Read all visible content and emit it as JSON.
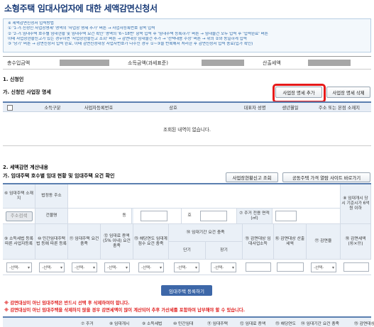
{
  "title": "소형주택 임대사업자에 대한 세액감면신청서",
  "guide": {
    "lines": [
      "※ 세액감면신청서 입력방법",
      "① '1-가.신청인 사업장명세' 영역의 '사업장 명세 추가' 버튼 → 사업자등록번호 항목 입력",
      "② '2-가.임대주택 호수별 임대현황 및 임대주택 요건 확인' 영역의 '6~18번' 항목 입력 후 '임대주택 등록하기' 버튼 → 임대물건 모두 입력 후 '입력완료' 버튼",
      "   이때 사업장현황신고가 있는 경우이면 '사업장현황신고 조회' 버튼 → 감면대상 임대물건 추가 → '선택내용 수정' 버튼 → 위의 ②와 동일하게 입력",
      "③ '당기' 버튼 → 감면신청서 입력 완료, 이때 감면신청대상 사업자번호가 다수인 경우 ①~③을 반복해서 처리한 후 감면신청서 입력 종료(입가 확인)"
    ]
  },
  "summary": {
    "total_income_label": "총수입금액",
    "income_amount_label": "소득금액(과세표준)",
    "tax_label": "산출세액"
  },
  "section1": {
    "heading": "1. 신청인",
    "subheading": "가. 신청인 사업장 명세",
    "add_button": "사업장 명세 추가",
    "delete_button": "사업장 명세 삭제",
    "columns": [
      "소득구분",
      "사업자등록번호",
      "상호",
      "대표자 성명",
      "생년월일",
      "주소 또는 본점 소재지"
    ],
    "empty_message": "조회된 내역이 없습니다."
  },
  "section2": {
    "heading": "2. 세액감면 계산내용",
    "subheading": "가. 임대주택 호수별 임대 현황 및 임대주택 요건 확인",
    "lookup_button": "사업장현황신고 조회",
    "price_button": "공동주택 가격 열람 사이트 바로가기",
    "row1": {
      "c1": "⑥ 임대주택 소재지",
      "c2": "법정동 주소",
      "c7": "⑧ 임대개시 당시 기준시가 6억원 이하"
    },
    "row2": {
      "address_search": "주소검색",
      "building_no": "건물명",
      "dong": "동",
      "ho": "호",
      "area": "⑦ 주거 전용 면적 (㎡)"
    },
    "row3": [
      "⑨ 소득세법 등록 따른 사업자등록",
      "⑩ 민간임대주택법 등에 따른 등록",
      "⑪ 임대주택 요건 충족",
      "⑫ 임대료 증액 (5% 이내) 요건 충족",
      "⑬ 해당연도 임대계점수 요건 충족",
      "⑭ 임대기간 요건 충족",
      "⑮ 감면대상 임대사업소득",
      "⑯ 감면대상 산출세액",
      "⑰ 감면율",
      "⑱ 감면세액 (⑯×⑰)"
    ],
    "period_short": "단기",
    "period_long": "장기",
    "select_placeholder": "-선택-",
    "register_button": "임대주택 등록하기"
  },
  "warnings": [
    "※ 감면대상이 아닌 임대주택은 반드시 선택 후 삭제하여야 합니다.",
    "※ 감면대상이 아닌 임대주택을 삭제하지 않을 경우 감면세액이 많이 계산되어 추후 가산세를 포함하여 납부해야 할 수 있습니다."
  ],
  "bottom_columns": [
    "⑦ 주거",
    "⑧ 임대개시",
    "⑨ 소득세법",
    "⑩ 민간임대",
    "⑪ 임대주택",
    "⑫ 임대료 증액",
    "⑬ 해당연도",
    "⑭ 임대기간 요건 충족",
    "⑮ 감면대상"
  ]
}
